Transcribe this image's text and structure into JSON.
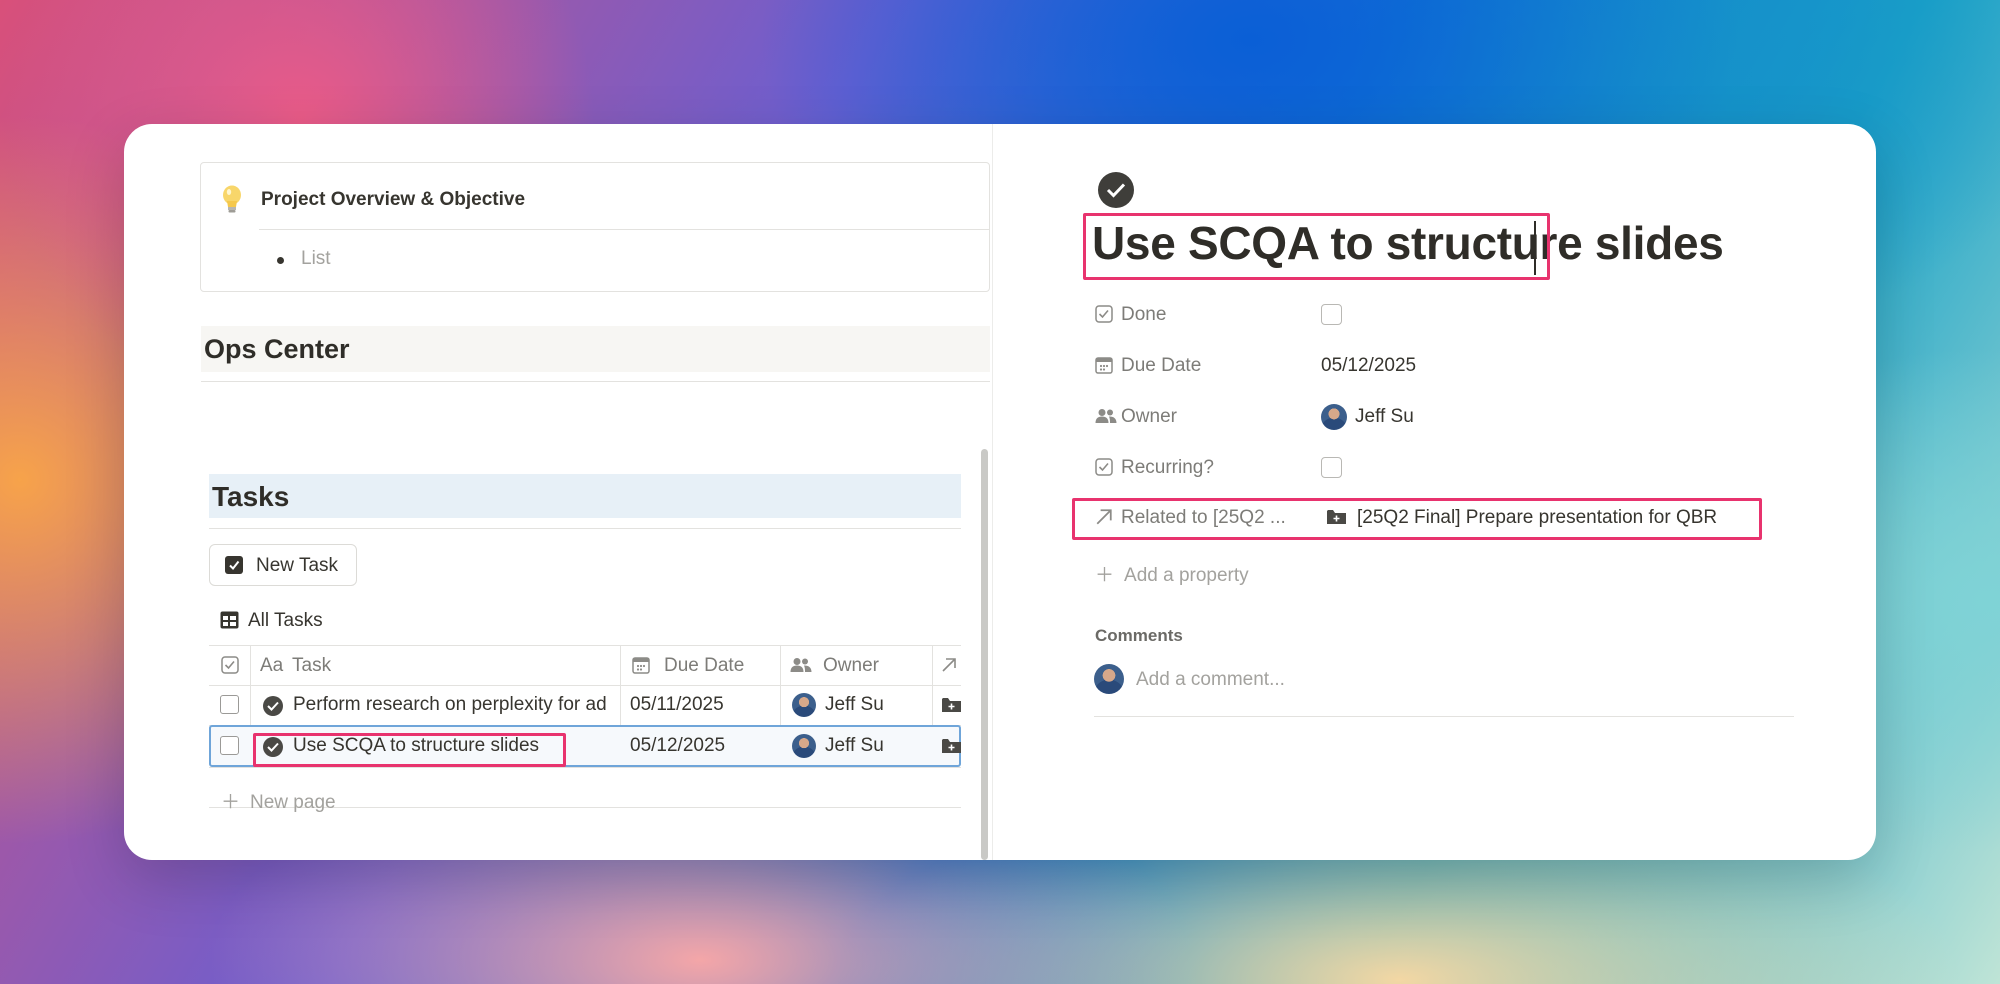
{
  "left_panel": {
    "callout": {
      "title": "Project Overview & Objective",
      "bullet": "List",
      "icon": "lightbulb-icon"
    },
    "ops_heading": "Ops Center",
    "tasks_heading": "Tasks",
    "new_task_button": "New Task",
    "view_label": "All Tasks",
    "table": {
      "columns": [
        "Aa",
        "Task",
        "Due Date",
        "Owner"
      ],
      "rows": [
        {
          "task": "Perform research on perplexity for ad",
          "due": "05/11/2025",
          "owner": "Jeff Su",
          "selected": false
        },
        {
          "task": "Use SCQA to structure slides",
          "due": "05/12/2025",
          "owner": "Jeff Su",
          "selected": true
        }
      ],
      "new_page": "New page"
    }
  },
  "right_panel": {
    "title": "Use SCQA to structure slides",
    "properties": {
      "done_label": "Done",
      "due_label": "Due Date",
      "due_value": "05/12/2025",
      "owner_label": "Owner",
      "owner_value": "Jeff Su",
      "recurring_label": "Recurring?",
      "related_label": "Related to [25Q2 ...",
      "related_value": "[25Q2 Final] Prepare presentation for QBR"
    },
    "add_property": "Add a property",
    "comments_label": "Comments",
    "comment_placeholder": "Add a comment..."
  },
  "colors": {
    "highlight": "#e8336e",
    "selection": "#6fa5d9",
    "tasks_heading_bg": "#e7f0f7",
    "ops_heading_bg": "#f7f6f3"
  }
}
